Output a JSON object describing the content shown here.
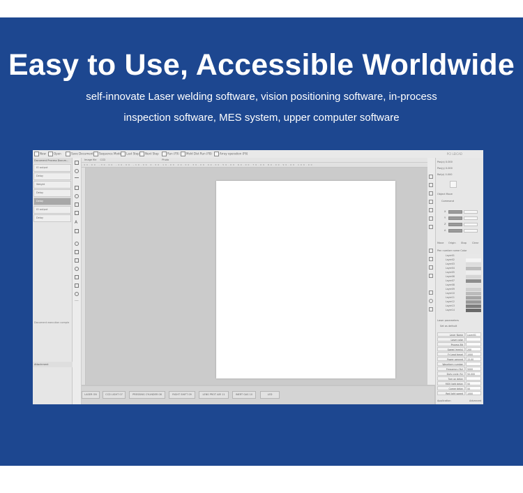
{
  "headline": "Easy to Use, Accessible Worldwide",
  "subtitle_line1": "self-innovate Laser welding software, vision positioning software, in-process",
  "subtitle_line2": "inspection software, MES system, upper computer software",
  "colors": {
    "banner": "#1d4790",
    "text": "#ffffff",
    "screenshot_bg": "#c6c6c6"
  },
  "software": {
    "toolbar": [
      {
        "label": "New",
        "icon": "new-file-icon"
      },
      {
        "label": "Open",
        "icon": "folder-icon"
      },
      {
        "label": "Save Document",
        "icon": "save-icon"
      },
      {
        "label": "Sequence Mode",
        "icon": "sequence-icon"
      },
      {
        "label": "Last Step",
        "icon": "step-back-icon"
      },
      {
        "label": "Next Step",
        "icon": "step-forward-icon"
      },
      {
        "label": "Run (F9)",
        "icon": "run-icon"
      },
      {
        "label": "Mold Dist Run (F8)",
        "icon": "run-mold-icon"
      },
      {
        "label": "Array operation (F6)",
        "icon": "array-icon"
      }
    ],
    "left_panel": {
      "tabs": "Document Process   Docum...",
      "items": [
        {
          "label": "IO output",
          "selected": false
        },
        {
          "label": "Delay",
          "selected": false
        },
        {
          "label": "Weight",
          "selected": false
        },
        {
          "label": "Delay",
          "selected": false
        },
        {
          "label": "Delay",
          "selected": true
        },
        {
          "label": "IO output",
          "selected": false
        },
        {
          "label": "Delay",
          "selected": false
        }
      ],
      "status": "Document execution comple",
      "bottom": "Attachment"
    },
    "canvas": {
      "tabs": [
        "Image file",
        "CCD",
        "Photo"
      ],
      "ruler": "-40.00  -30.00  -20.00  -10.00  0.00  10.00  20.00  30.00  40.00  50.00  60.00  70.00  80.00  90.00  100.00"
    },
    "bottom_buttons": [
      "LASER ON",
      "CCD LIGHT 07",
      "PRESSING CYLINDER 08",
      "RIGHT SHIFT 09",
      "LENS PROT AIR 11",
      "INERT GAS 10",
      "LED"
    ],
    "right_panel": {
      "pos_labels": [
        "Pos(x) 0.000",
        "Pos(y) 0.000",
        "Rot(z) 0.000"
      ],
      "move_label": "Object Move",
      "control_label": "Command",
      "axes": [
        "X",
        "Y",
        "Z",
        "A"
      ],
      "buttons": [
        "Move",
        "Origin",
        "Stop",
        "Clear"
      ],
      "layers_header": "Pen number name     Color",
      "layers": [
        {
          "name": "Layer01",
          "color": "#e8e8e8"
        },
        {
          "name": "Layer02",
          "color": "#f4f4f4"
        },
        {
          "name": "Layer03",
          "color": "#dddddd"
        },
        {
          "name": "Layer04",
          "color": "#bdbdbd"
        },
        {
          "name": "Layer05",
          "color": "#eeeeee"
        },
        {
          "name": "Layer06",
          "color": "#d5d5d5"
        },
        {
          "name": "Layer07",
          "color": "#8d8d8d"
        },
        {
          "name": "Layer08",
          "color": "#e2e2e2"
        },
        {
          "name": "Layer09",
          "color": "#cfcfcf"
        },
        {
          "name": "Layer10",
          "color": "#bbbbbb"
        },
        {
          "name": "Layer11",
          "color": "#a5a5a5"
        },
        {
          "name": "Layer12",
          "color": "#9a9a9a"
        },
        {
          "name": "Layer13",
          "color": "#7e7e7e"
        },
        {
          "name": "Layer14",
          "color": "#6a6a6a"
        }
      ],
      "laser_params_label": "Laser parameters",
      "set_default": "Set as default",
      "params": [
        {
          "label": "Layer Name",
          "value": "Layer01"
        },
        {
          "label": "Laser color",
          "value": ""
        },
        {
          "label": "Process Bit",
          "value": ""
        },
        {
          "label": "Speed (mm/s)",
          "value": "200"
        },
        {
          "label": "Fr Lead travel",
          "value": "1000"
        },
        {
          "label": "Power percent",
          "value": "15.00"
        },
        {
          "label": "Waveform number",
          "value": ""
        },
        {
          "label": "Frequency (Hz)",
          "value": "5000"
        },
        {
          "label": "Duty cycle (%)",
          "value": "50.000"
        },
        {
          "label": "Turn on delay",
          "value": ""
        },
        {
          "label": "MOV light delay",
          "value": "50"
        },
        {
          "label": "Corner delay",
          "value": "50"
        },
        {
          "label": "Red light speed",
          "value": "1000"
        }
      ],
      "footer_left": "Application",
      "footer_right": "Advanced"
    },
    "window_title": "PCI LEICAD"
  }
}
